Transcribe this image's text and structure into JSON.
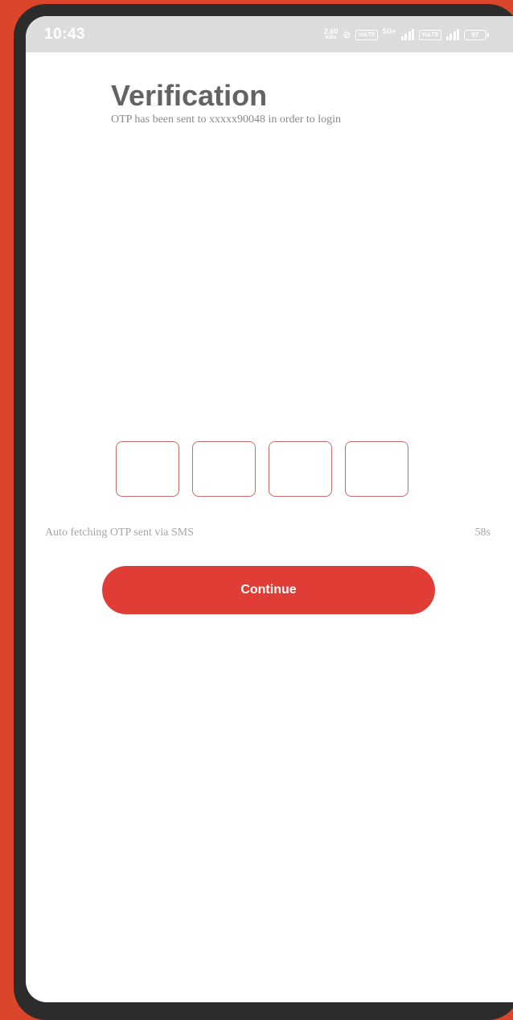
{
  "status_bar": {
    "time": "10:43",
    "net_speed_value": "2.60",
    "net_speed_unit": "KB/s",
    "sim1_label": "VoLTE",
    "net_type": "5G+",
    "sim2_label": "VoLTE",
    "battery": "97"
  },
  "header": {
    "title": "Verification",
    "subtitle": "OTP has been sent to xxxxx90048 in order to login"
  },
  "otp": {
    "digit_count": 4,
    "values": [
      "",
      "",
      "",
      ""
    ]
  },
  "auto_fetch": {
    "label": "Auto fetching OTP sent via SMS",
    "timer": "58s"
  },
  "actions": {
    "continue_label": "Continue"
  },
  "colors": {
    "accent": "#e03d37",
    "background": "#d9462a",
    "otp_border": "#c86b6b"
  }
}
